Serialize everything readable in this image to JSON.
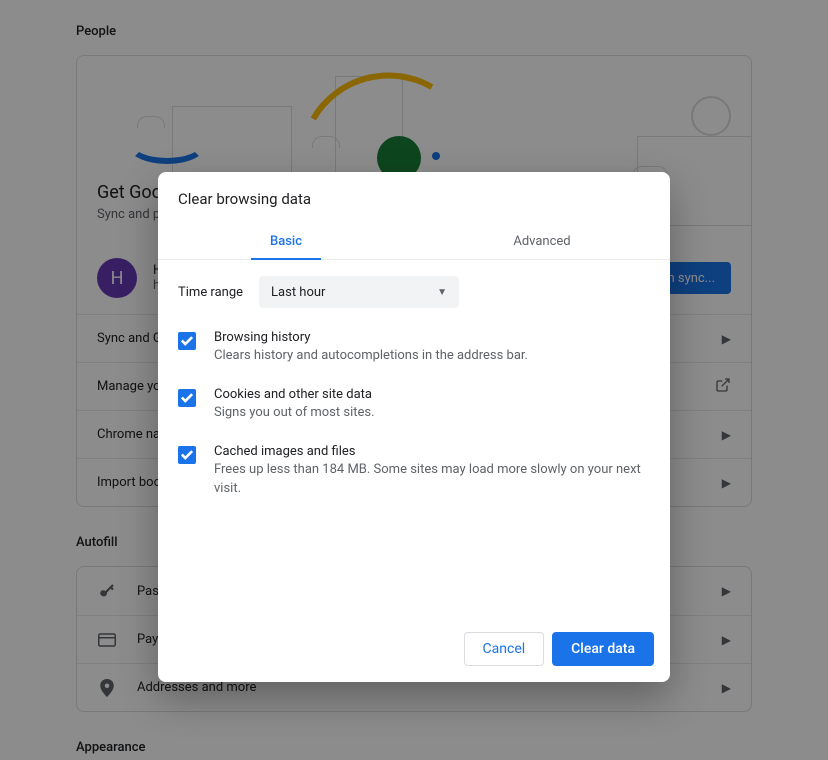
{
  "sections": {
    "people": {
      "title": "People",
      "hero_title": "Get Google smarts in Chrome",
      "hero_sub": "Sync and personalize Chrome across your devices",
      "profile": {
        "initial": "H",
        "name": "H",
        "email": "h"
      },
      "sync_button": "Turn on sync...",
      "items": [
        {
          "label": "Sync and Google services"
        },
        {
          "label": "Manage your Google Account"
        },
        {
          "label": "Chrome name and picture"
        },
        {
          "label": "Import bookmarks and settings"
        }
      ]
    },
    "autofill": {
      "title": "Autofill",
      "items": [
        {
          "label": "Passwords"
        },
        {
          "label": "Payment methods"
        },
        {
          "label": "Addresses and more"
        }
      ]
    },
    "appearance": {
      "title": "Appearance"
    }
  },
  "dialog": {
    "title": "Clear browsing data",
    "tabs": {
      "basic": "Basic",
      "advanced": "Advanced",
      "active": "basic"
    },
    "time_range": {
      "label": "Time range",
      "value": "Last hour"
    },
    "items": [
      {
        "title": "Browsing history",
        "sub": "Clears history and autocompletions in the address bar.",
        "checked": true
      },
      {
        "title": "Cookies and other site data",
        "sub": "Signs you out of most sites.",
        "checked": true
      },
      {
        "title": "Cached images and files",
        "sub": "Frees up less than 184 MB. Some sites may load more slowly on your next visit.",
        "checked": true
      }
    ],
    "actions": {
      "cancel": "Cancel",
      "confirm": "Clear data"
    }
  }
}
